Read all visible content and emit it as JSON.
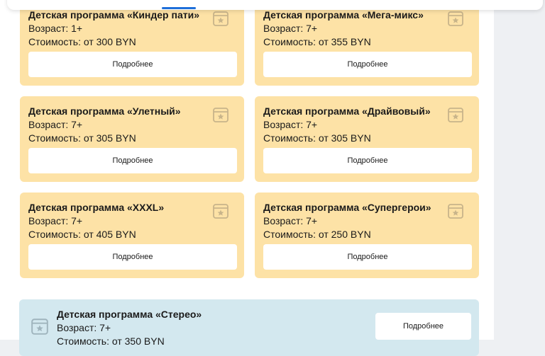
{
  "button_label": "Подробнее",
  "programs": [
    {
      "title": "Детская программа «Киндер пати»",
      "age": "Возраст: 1+",
      "price": "Стоимость: от 300 BYN"
    },
    {
      "title": "Детская программа «Мега-микс»",
      "age": "Возраст: 7+",
      "price": "Стоимость: от 355 BYN"
    },
    {
      "title": "Детская программа «Улетный»",
      "age": "Возраст: 7+",
      "price": "Стоимость: от 305 BYN"
    },
    {
      "title": "Детская программа «Драйвовый»",
      "age": "Возраст: 7+",
      "price": "Стоимость: от 305 BYN"
    },
    {
      "title": "Детская программа «XXXL»",
      "age": "Возраст: 7+",
      "price": "Стоимость: от 405 BYN"
    },
    {
      "title": "Детская программа «Супергерои»",
      "age": "Возраст: 7+",
      "price": "Стоимость: от 250 BYN"
    },
    {
      "title": "Детская программа «Стерео»",
      "age": "Возраст: 7+",
      "price": "Стоимость: от 350 BYN"
    }
  ],
  "colors": {
    "card_yellow": "#fde2a6",
    "card_blue": "#d3e8ef",
    "icon": "#c8b48a",
    "accent": "#1e6fd9"
  },
  "icons": {
    "card": "calendar-star-icon"
  }
}
